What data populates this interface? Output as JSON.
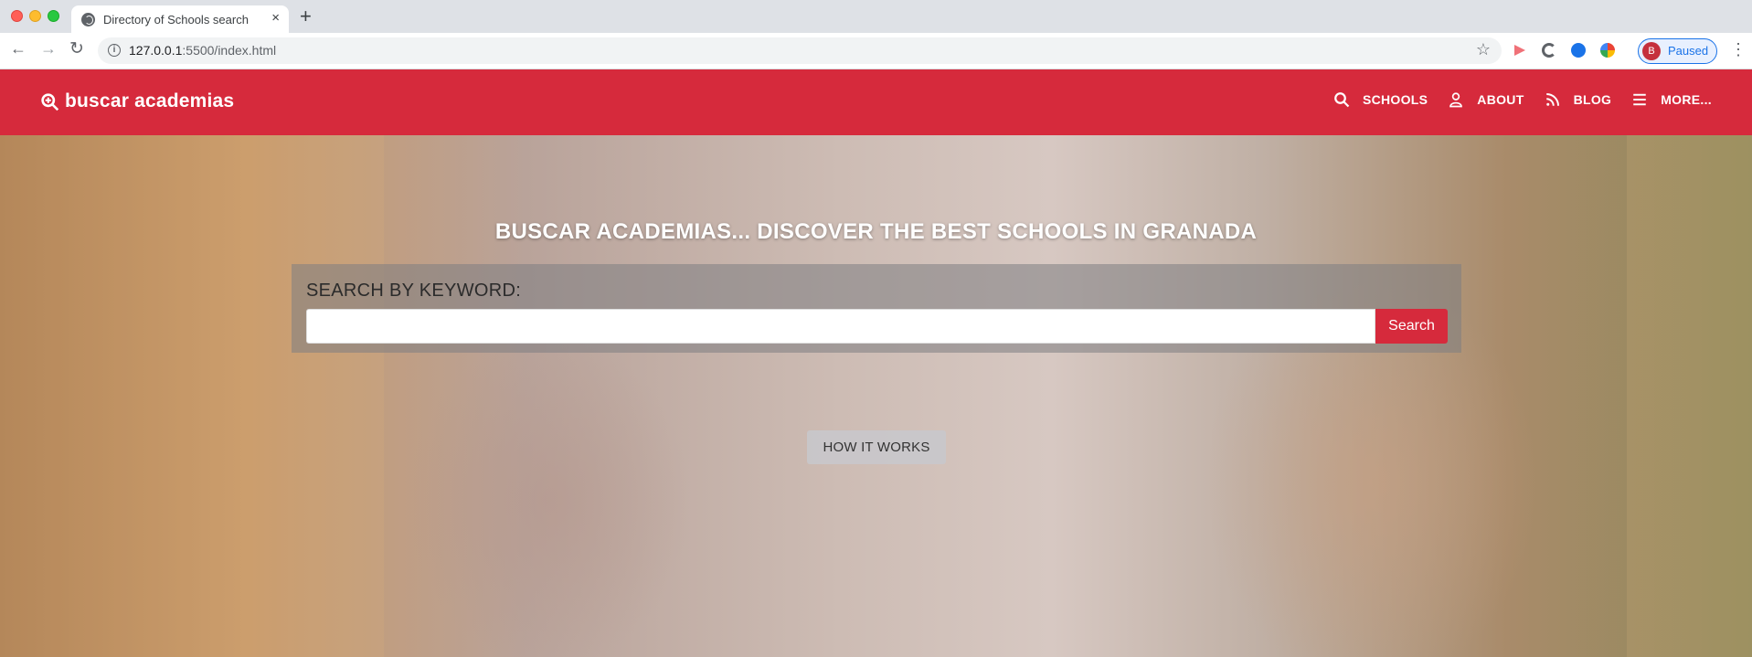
{
  "browser": {
    "tab_title": "Directory of Schools search",
    "tab_close": "×",
    "new_tab": "+",
    "url_host": "127.0.0.1",
    "url_path": ":5500/index.html",
    "profile_initial": "B",
    "profile_status": "Paused"
  },
  "header": {
    "brand": "buscar academias",
    "brand_color": "#d62a3c",
    "nav": [
      {
        "label": "SCHOOLS",
        "icon": "search-icon"
      },
      {
        "label": "ABOUT",
        "icon": "user-icon"
      },
      {
        "label": "BLOG",
        "icon": "rss-icon"
      },
      {
        "label": "MORE...",
        "icon": "menu-icon"
      }
    ]
  },
  "hero": {
    "title": "BUSCAR ACADEMIAS... DISCOVER THE BEST SCHOOLS IN GRANADA",
    "search_heading": "SEARCH BY KEYWORD:",
    "search_value": "",
    "search_button": "Search",
    "how_it_works": "HOW IT WORKS"
  }
}
